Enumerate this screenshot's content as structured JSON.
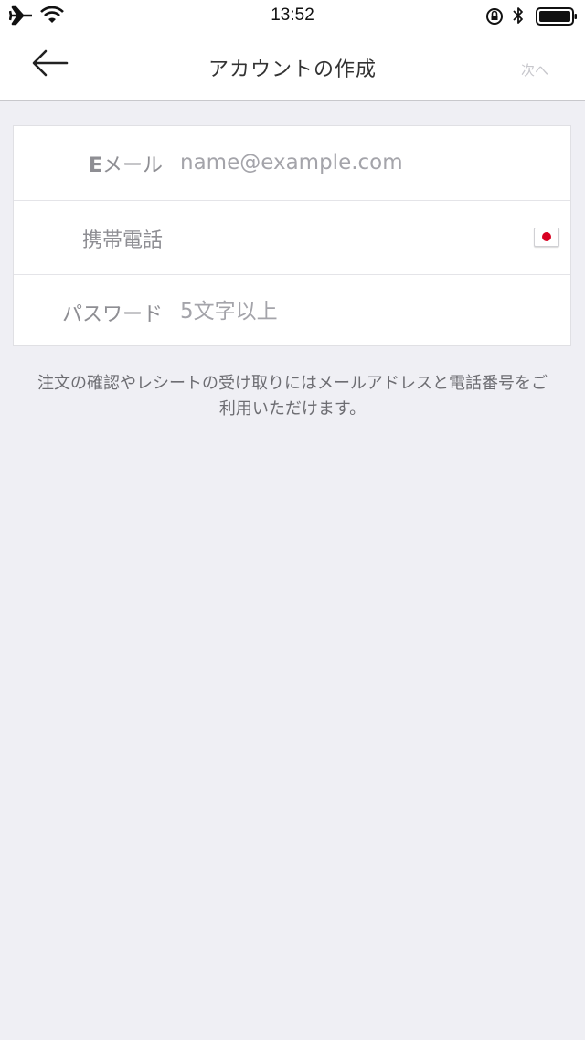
{
  "status_bar": {
    "time": "13:52"
  },
  "nav": {
    "title": "アカウントの作成",
    "next_label": "次へ"
  },
  "form": {
    "email": {
      "label_prefix": "E",
      "label_rest": "メール",
      "placeholder": "name@example.com",
      "value": ""
    },
    "phone": {
      "label": "携帯電話",
      "placeholder": "",
      "value": "",
      "country_flag": "japan-flag-icon"
    },
    "password": {
      "label": "パスワード",
      "placeholder": "5文字以上",
      "value": ""
    }
  },
  "info": {
    "text": "注文の確認やレシートの受け取りにはメールアドレスと電話番号をご利用いただけます。"
  },
  "colors": {
    "background": "#efeff4",
    "flag_red": "#d80021",
    "disabled_text": "#c7c7cc"
  }
}
